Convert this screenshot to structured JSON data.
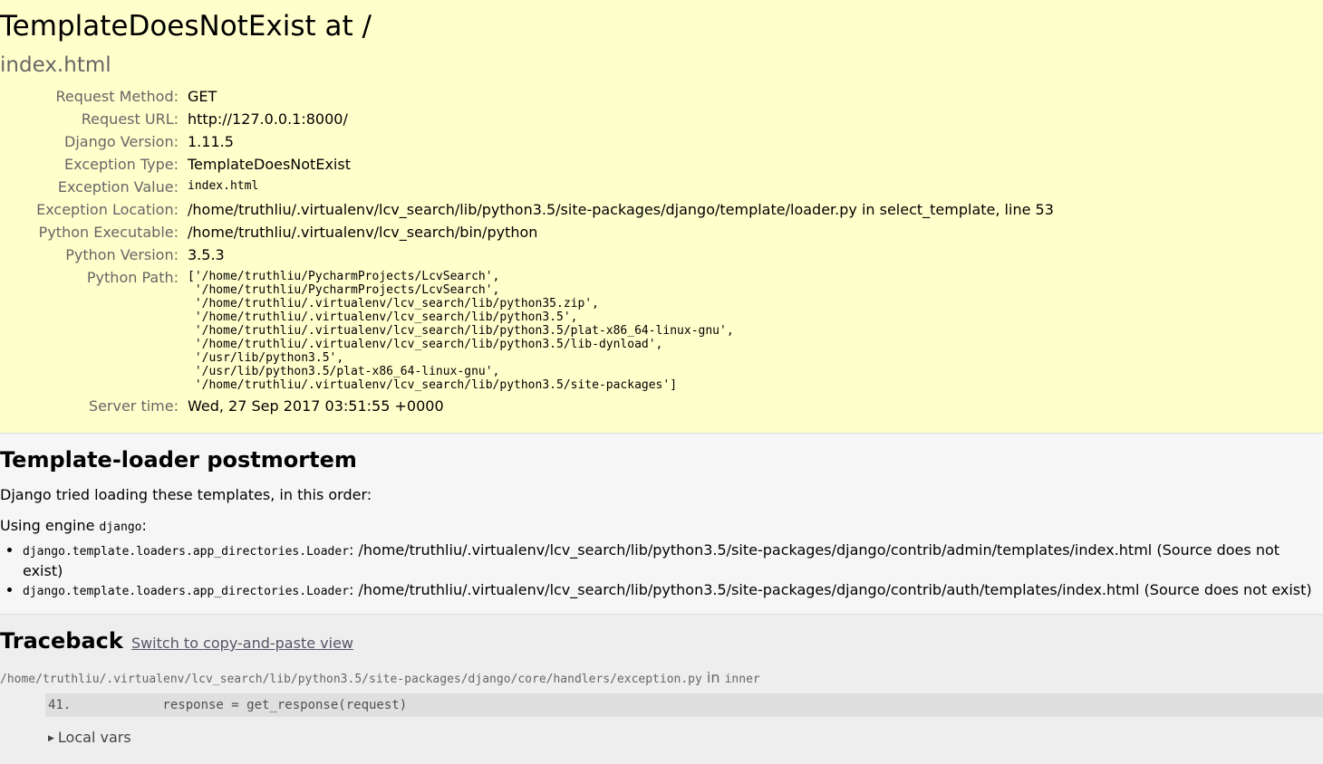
{
  "summary": {
    "title": "TemplateDoesNotExist at /",
    "subtitle": "index.html",
    "rows": [
      {
        "label": "Request Method:",
        "value": "GET"
      },
      {
        "label": "Request URL:",
        "value": "http://127.0.0.1:8000/"
      },
      {
        "label": "Django Version:",
        "value": "1.11.5"
      },
      {
        "label": "Exception Type:",
        "value": "TemplateDoesNotExist"
      },
      {
        "label": "Exception Value:",
        "value": "index.html"
      },
      {
        "label": "Exception Location:",
        "value": "/home/truthliu/.virtualenv/lcv_search/lib/python3.5/site-packages/django/template/loader.py in select_template, line 53"
      },
      {
        "label": "Python Executable:",
        "value": "/home/truthliu/.virtualenv/lcv_search/bin/python"
      },
      {
        "label": "Python Version:",
        "value": "3.5.3"
      },
      {
        "label": "Python Path:",
        "value": "['/home/truthliu/PycharmProjects/LcvSearch',\n '/home/truthliu/PycharmProjects/LcvSearch',\n '/home/truthliu/.virtualenv/lcv_search/lib/python35.zip',\n '/home/truthliu/.virtualenv/lcv_search/lib/python3.5',\n '/home/truthliu/.virtualenv/lcv_search/lib/python3.5/plat-x86_64-linux-gnu',\n '/home/truthliu/.virtualenv/lcv_search/lib/python3.5/lib-dynload',\n '/usr/lib/python3.5',\n '/usr/lib/python3.5/plat-x86_64-linux-gnu',\n '/home/truthliu/.virtualenv/lcv_search/lib/python3.5/site-packages']"
      },
      {
        "label": "Server time:",
        "value": "Wed, 27 Sep 2017 03:51:55 +0000"
      }
    ]
  },
  "postmortem": {
    "heading": "Template-loader postmortem",
    "intro": "Django tried loading these templates, in this order:",
    "engine_prefix": "Using engine ",
    "engine_name": "django",
    "engine_suffix": ":",
    "items": [
      {
        "loader": "django.template.loaders.app_directories.Loader",
        "path": ": /home/truthliu/.virtualenv/lcv_search/lib/python3.5/site-packages/django/contrib/admin/templates/index.html (Source does not exist)"
      },
      {
        "loader": "django.template.loaders.app_directories.Loader",
        "path": ": /home/truthliu/.virtualenv/lcv_search/lib/python3.5/site-packages/django/contrib/auth/templates/index.html (Source does not exist)"
      }
    ]
  },
  "traceback": {
    "heading": "Traceback",
    "switch_link": "Switch to copy-and-paste view",
    "frame": {
      "file": "/home/truthliu/.virtualenv/lcv_search/lib/python3.5/site-packages/django/core/handlers/exception.py",
      "in_word": " in ",
      "func": "inner",
      "line": "41.            response = get_response(request)",
      "local_vars": "Local vars"
    }
  }
}
